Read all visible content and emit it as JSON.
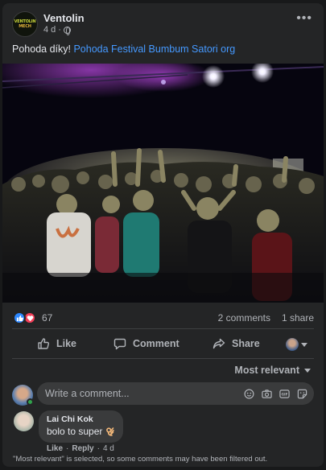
{
  "post": {
    "author": "Ventolin",
    "avatar_text_line1": "VENTOLIN",
    "avatar_text_line2": "MECH",
    "time": "4 d",
    "privacy_icon": "globe-icon",
    "menu_icon": "more-horizontal-icon",
    "text": "Pohoda díky!",
    "tag_text": "Pohoda Festival Bumbum Satori org"
  },
  "photo": {
    "description_icon": "concert-crowd-photo"
  },
  "stats": {
    "reaction_icons": [
      "like-reaction-icon",
      "love-reaction-icon"
    ],
    "reaction_count": "67",
    "comments": "2 comments",
    "shares": "1 share"
  },
  "actions": {
    "like": "Like",
    "comment": "Comment",
    "share": "Share"
  },
  "comments": {
    "sort_label": "Most relevant",
    "composer_placeholder": "Write a comment...",
    "composer_icons": [
      "emoji-icon",
      "camera-icon",
      "gif-icon",
      "sticker-icon"
    ],
    "items": [
      {
        "author": "Lai Chi Kok",
        "text": "bolo to super",
        "like_label": "Like",
        "reply_label": "Reply",
        "time": "4 d"
      }
    ],
    "filter_notice": "\"Most relevant\" is selected, so some comments may have been filtered out."
  },
  "colors": {
    "background": "#18191a",
    "card": "#242526",
    "link": "#4599ff",
    "like_blue": "#2d88ff",
    "love_red": "#f33e58",
    "online_green": "#31a24c"
  }
}
